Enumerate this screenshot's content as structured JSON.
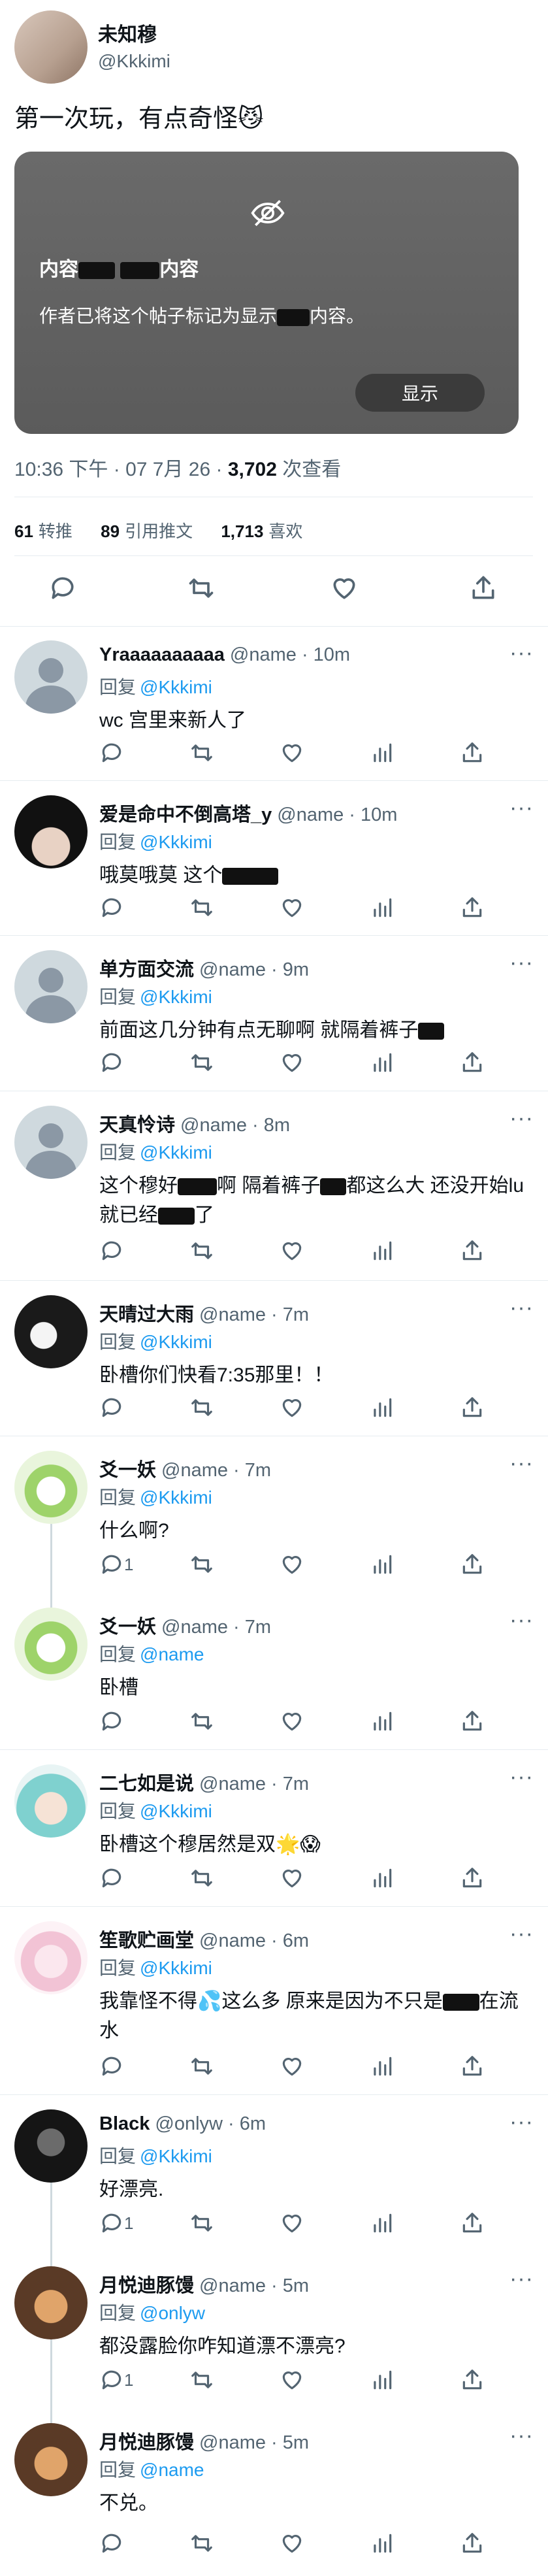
{
  "tweet": {
    "display_name": "未知穆",
    "handle": "@Kkkimi",
    "text": "第一次玩，有点奇怪😼",
    "sensitive_card": {
      "title_pre": "内容",
      "title_post": "内容",
      "desc_pre": "作者已将这个帖子标记为显示",
      "desc_post": "内容。",
      "show_label": "显示"
    },
    "time": "10:36 下午 · 07 7月 26 · ",
    "views_count": "3,702",
    "views_label": " 次查看",
    "stats": {
      "retweets_count": "61",
      "retweets_label": "转推",
      "quotes_count": "89",
      "quotes_label": "引用推文",
      "likes_count": "1,713",
      "likes_label": "喜欢"
    }
  },
  "replies": [
    {
      "name": "Yraaaaaaaaaa",
      "handle": "@name · 10m",
      "reply_prefix": "回复",
      "reply_to": "@Kkkimi",
      "text": "wc  宫里来新人了",
      "reply_count": ""
    },
    {
      "name": "爱是命中不倒高塔_y",
      "handle": "@name · 10m",
      "reply_prefix": "回复",
      "reply_to": "@Kkkimi",
      "text": "哦莫哦莫  这个",
      "reply_count": ""
    },
    {
      "name": "单方面交流",
      "handle": "@name · 9m",
      "reply_prefix": "回复",
      "reply_to": "@Kkkimi",
      "text": "前面这几分钟有点无聊啊  就隔着裤子",
      "reply_count": ""
    },
    {
      "name": "天真怜诗",
      "handle": "@name · 8m",
      "reply_prefix": "回复",
      "reply_to": "@Kkkimi",
      "text_a": "这个穆好",
      "text_b": "啊  隔着裤子",
      "text_c": "都这么大  还没开始lu就已经",
      "text_d": "了",
      "reply_count": ""
    },
    {
      "name": "天晴过大雨",
      "handle": "@name · 7m",
      "reply_prefix": "回复",
      "reply_to": "@Kkkimi",
      "text": "卧槽你们快看7:35那里！！",
      "reply_count": ""
    },
    {
      "name": "爻一妖",
      "handle": "@name · 7m",
      "reply_prefix": "回复",
      "reply_to": "@Kkkimi",
      "text": "什么啊?",
      "reply_count": "1"
    },
    {
      "name": "爻一妖",
      "handle": "@name · 7m",
      "reply_prefix": "回复",
      "reply_to": "@name",
      "text": "卧槽",
      "reply_count": ""
    },
    {
      "name": "二七如是说",
      "handle": "@name · 7m",
      "reply_prefix": "回复",
      "reply_to": "@Kkkimi",
      "text": "卧槽这个穆居然是双🌟😱",
      "reply_count": ""
    },
    {
      "name": "笙歌贮画堂",
      "handle": "@name · 6m",
      "reply_prefix": "回复",
      "reply_to": "@Kkkimi",
      "text_a": "我靠怪不得💦这么多  原来是因为不只是",
      "text_b": "在流水",
      "reply_count": ""
    },
    {
      "name": "Black",
      "handle": "@onlyw · 6m",
      "reply_prefix": "回复",
      "reply_to": "@Kkkimi",
      "text": "好漂亮.",
      "reply_count": "1"
    },
    {
      "name": "月悦迪豚馒",
      "handle": "@name · 5m",
      "reply_prefix": "回复",
      "reply_to": "@onlyw",
      "text": "都没露脸你咋知道漂不漂亮?",
      "reply_count": "1"
    },
    {
      "name": "月悦迪豚馒",
      "handle": "@name · 5m",
      "reply_prefix": "回复",
      "reply_to": "@name",
      "text": "不兑。",
      "reply_count": ""
    }
  ]
}
